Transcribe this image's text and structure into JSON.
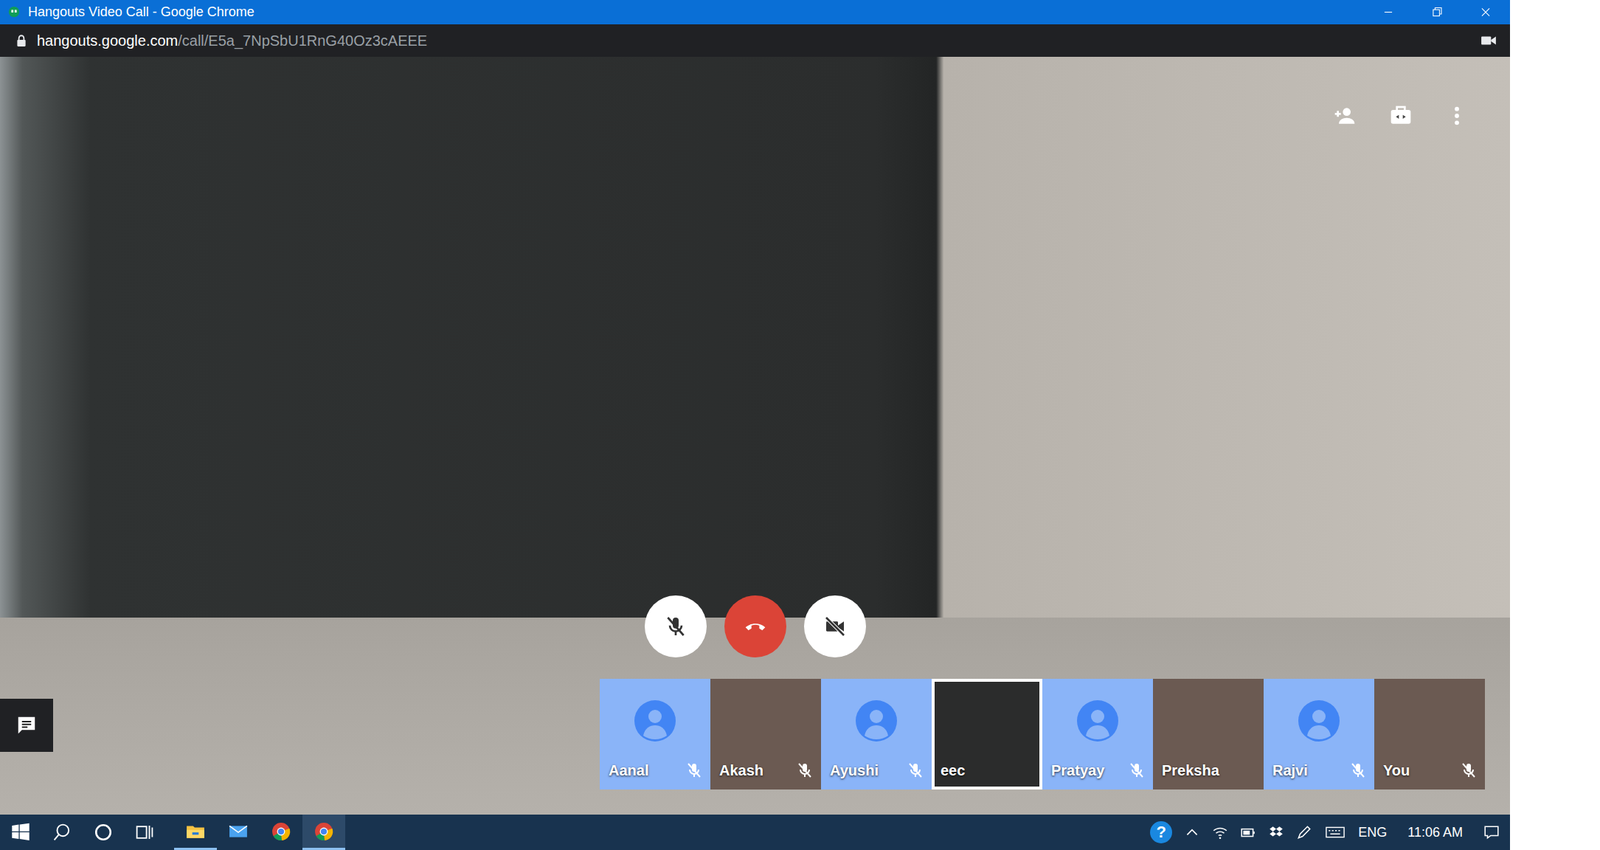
{
  "window": {
    "title": "Hangouts Video Call - Google Chrome"
  },
  "address_bar": {
    "url_host": "hangouts.google.com",
    "url_path": "/call/E5a_7NpSbU1RnG40Oz3cAEEE",
    "secure": true
  },
  "call": {
    "mic_muted": true,
    "camera_off": true
  },
  "participants": [
    {
      "name": "Aanal",
      "kind": "avatar",
      "muted": true,
      "selected": false
    },
    {
      "name": "Akash",
      "kind": "photo",
      "muted": true,
      "selected": false
    },
    {
      "name": "Ayushi",
      "kind": "avatar",
      "muted": true,
      "selected": false
    },
    {
      "name": "eec",
      "kind": "video",
      "muted": false,
      "selected": true
    },
    {
      "name": "Pratyay",
      "kind": "avatar",
      "muted": true,
      "selected": false
    },
    {
      "name": "Preksha",
      "kind": "photo",
      "muted": false,
      "selected": false
    },
    {
      "name": "Rajvi",
      "kind": "avatar",
      "muted": true,
      "selected": false
    },
    {
      "name": "You",
      "kind": "photo",
      "muted": true,
      "selected": false
    }
  ],
  "taskbar": {
    "apps": [
      {
        "kind": "explorer",
        "running": true,
        "active": false
      },
      {
        "kind": "mail",
        "running": false,
        "active": false
      },
      {
        "kind": "chrome",
        "running": false,
        "active": false
      },
      {
        "kind": "chrome",
        "running": true,
        "active": true
      }
    ]
  },
  "tray": {
    "help": "?",
    "language": "ENG",
    "time": "11:06 AM"
  }
}
